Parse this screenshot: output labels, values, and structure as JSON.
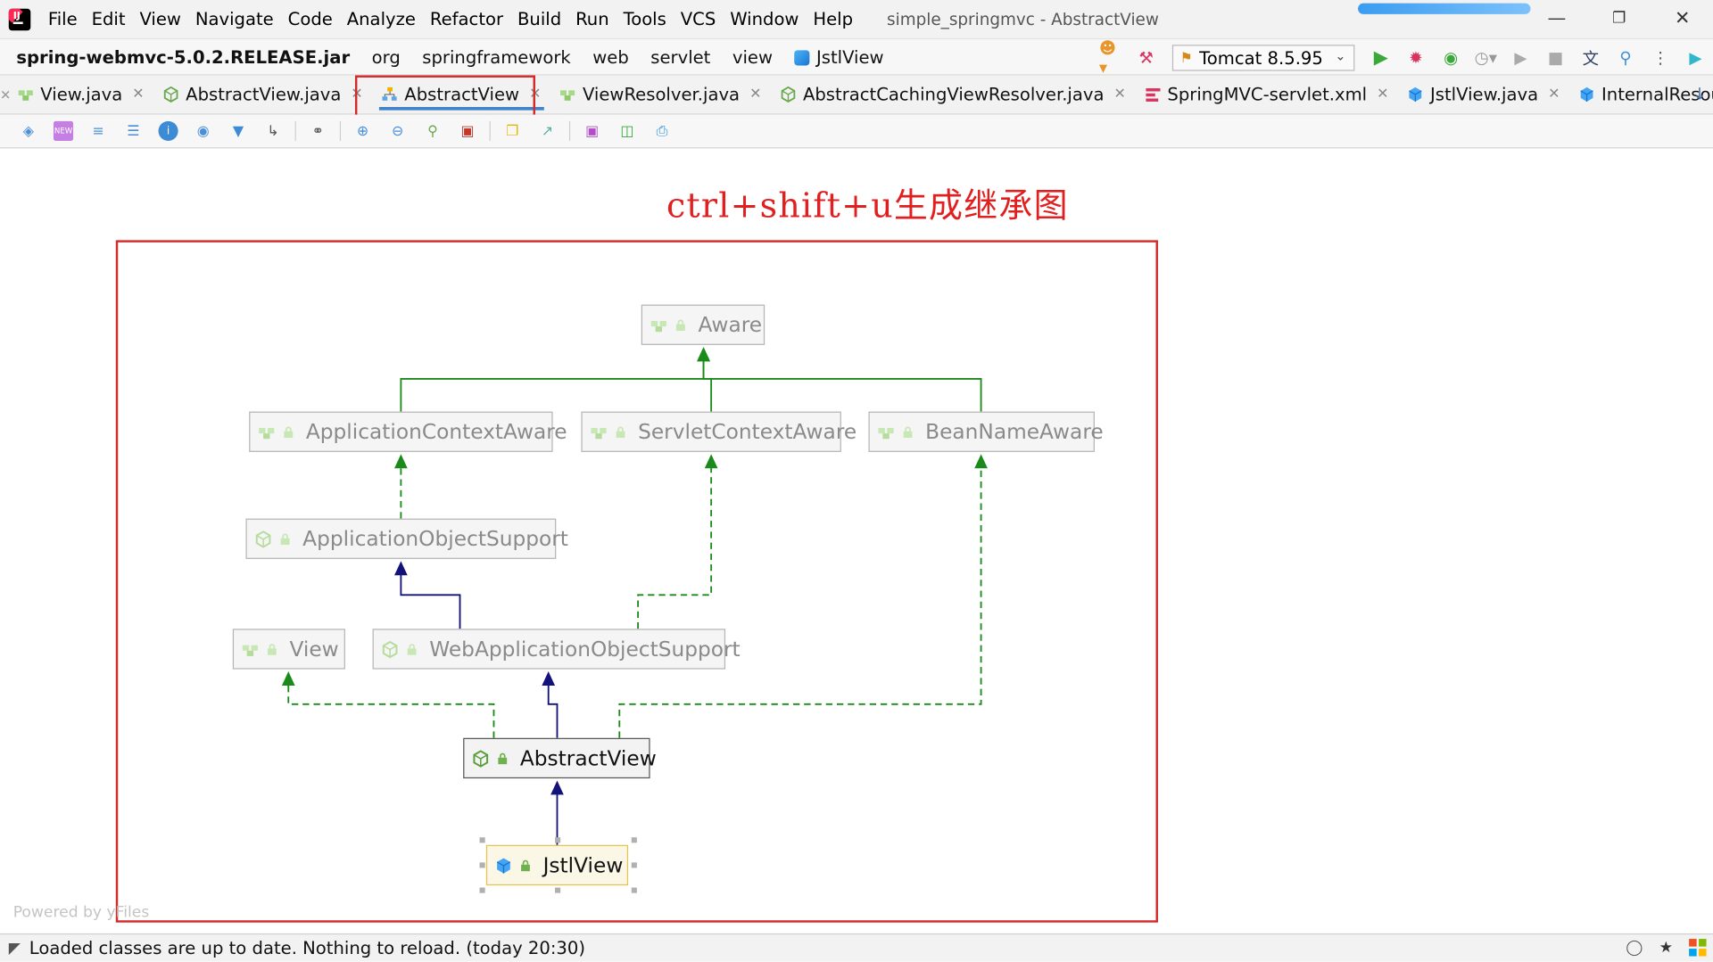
{
  "menu": {
    "items": [
      {
        "label": "File"
      },
      {
        "label": "Edit"
      },
      {
        "label": "View"
      },
      {
        "label": "Navigate"
      },
      {
        "label": "Code"
      },
      {
        "label": "Analyze"
      },
      {
        "label": "Refactor"
      },
      {
        "label": "Build"
      },
      {
        "label": "Run"
      },
      {
        "label": "Tools"
      },
      {
        "label": "VCS"
      },
      {
        "label": "Window"
      },
      {
        "label": "Help"
      }
    ],
    "window_title": "simple_springmvc - AbstractView"
  },
  "navbar": {
    "crumbs": [
      "spring-webmvc-5.0.2.RELEASE.jar",
      "org",
      "springframework",
      "web",
      "servlet",
      "view",
      "JstlView"
    ],
    "run_config": "Tomcat 8.5.95"
  },
  "tabs": [
    {
      "label": "View.java",
      "icon": "interface-icon"
    },
    {
      "label": "AbstractView.java",
      "icon": "abstract-class-icon"
    },
    {
      "label": "AbstractView",
      "icon": "diagram-icon",
      "active": true
    },
    {
      "label": "ViewResolver.java",
      "icon": "interface-icon"
    },
    {
      "label": "AbstractCachingViewResolver.java",
      "icon": "abstract-class-icon"
    },
    {
      "label": "SpringMVC-servlet.xml",
      "icon": "xml-icon"
    },
    {
      "label": "JstlView.java",
      "icon": "class-icon"
    },
    {
      "label": "InternalResourceView.jav",
      "icon": "class-icon"
    }
  ],
  "diagram": {
    "annotation": "ctrl+shift+u生成继承图",
    "powered_by": "Powered by yFiles",
    "nodes": {
      "aware": "Aware",
      "application_context_aware": "ApplicationContextAware",
      "servlet_context_aware": "ServletContextAware",
      "bean_name_aware": "BeanNameAware",
      "application_object_support": "ApplicationObjectSupport",
      "view": "View",
      "web_application_object_support": "WebApplicationObjectSupport",
      "abstract_view": "AbstractView",
      "jstl_view": "JstlView"
    },
    "edges": [
      {
        "from": "application_context_aware",
        "to": "aware",
        "kind": "extends-interface"
      },
      {
        "from": "servlet_context_aware",
        "to": "aware",
        "kind": "extends-interface"
      },
      {
        "from": "bean_name_aware",
        "to": "aware",
        "kind": "extends-interface"
      },
      {
        "from": "application_object_support",
        "to": "application_context_aware",
        "kind": "implements"
      },
      {
        "from": "web_application_object_support",
        "to": "application_object_support",
        "kind": "extends"
      },
      {
        "from": "web_application_object_support",
        "to": "servlet_context_aware",
        "kind": "implements"
      },
      {
        "from": "abstract_view",
        "to": "view",
        "kind": "implements"
      },
      {
        "from": "abstract_view",
        "to": "web_application_object_support",
        "kind": "extends"
      },
      {
        "from": "abstract_view",
        "to": "bean_name_aware",
        "kind": "implements"
      },
      {
        "from": "jstl_view",
        "to": "abstract_view",
        "kind": "extends"
      }
    ],
    "colors": {
      "interface_edge": "#1a8a1a",
      "class_edge": "#12127a",
      "highlight": "#d42a2a"
    }
  },
  "status": {
    "message": "Loaded classes are up to date. Nothing to reload. (today 20:30)"
  }
}
